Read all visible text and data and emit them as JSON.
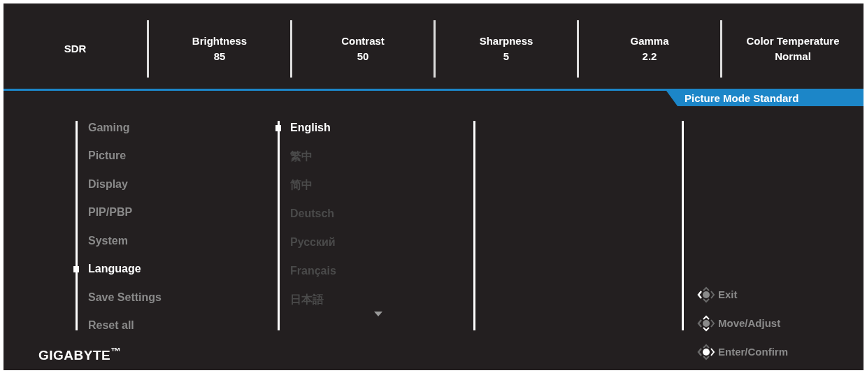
{
  "header": [
    {
      "label": "SDR"
    },
    {
      "label": "Brightness",
      "value": "85"
    },
    {
      "label": "Contrast",
      "value": "50"
    },
    {
      "label": "Sharpness",
      "value": "5"
    },
    {
      "label": "Gamma",
      "value": "2.2"
    },
    {
      "label": "Color Temperature",
      "value": "Normal"
    }
  ],
  "mode_tab": "Picture Mode Standard",
  "menu": [
    {
      "label": "Gaming",
      "selected": false
    },
    {
      "label": "Picture",
      "selected": false
    },
    {
      "label": "Display",
      "selected": false
    },
    {
      "label": "PIP/PBP",
      "selected": false
    },
    {
      "label": "System",
      "selected": false
    },
    {
      "label": "Language",
      "selected": true
    },
    {
      "label": "Save Settings",
      "selected": false
    },
    {
      "label": "Reset all",
      "selected": false
    }
  ],
  "languages": [
    {
      "label": "English",
      "selected": true
    },
    {
      "label": "繁中",
      "selected": false
    },
    {
      "label": "简中",
      "selected": false
    },
    {
      "label": "Deutsch",
      "selected": false
    },
    {
      "label": "Русский",
      "selected": false
    },
    {
      "label": "Français",
      "selected": false
    },
    {
      "label": "日本語",
      "selected": false
    }
  ],
  "hints": [
    {
      "kind": "left",
      "label": "Exit"
    },
    {
      "kind": "vertical",
      "label": "Move/Adjust"
    },
    {
      "kind": "center",
      "label": "Enter/Confirm"
    }
  ],
  "logo": "GIGABYTE$^{™}$"
}
